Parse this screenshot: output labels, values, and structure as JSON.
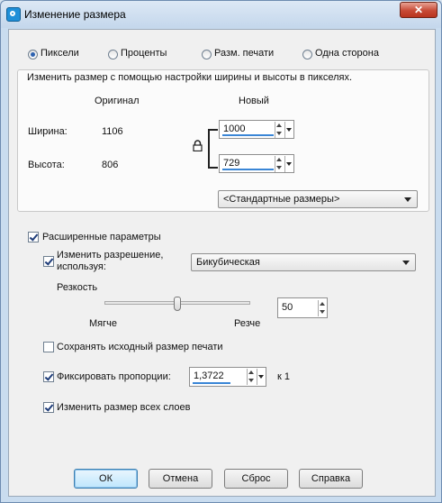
{
  "window": {
    "title": "Изменение размера",
    "close_glyph": "✕"
  },
  "mode": {
    "options": [
      "Пиксели",
      "Проценты",
      "Разм. печати",
      "Одна сторона"
    ],
    "selected": "Пиксели"
  },
  "dimensions": {
    "description": "Изменить размер с помощью настройки ширины и высоты в пикселях.",
    "original_header": "Оригинал",
    "new_header": "Новый",
    "width_label": "Ширина:",
    "width_original": "1106",
    "width_new": "1000",
    "height_label": "Высота:",
    "height_original": "806",
    "height_new": "729",
    "preset_value": "<Стандартные размеры>"
  },
  "advanced": {
    "label": "Расширенные параметры",
    "checked": true,
    "resample_label_line1": "Изменить разрешение,",
    "resample_label_line2": "используя:",
    "resample_checked": true,
    "resample_method": "Бикубическая",
    "sharpness_label": "Резкость",
    "sharpness_value": "50",
    "sharpness_level": 0.5,
    "softer_label": "Мягче",
    "sharper_label": "Резче",
    "keep_print_label": "Сохранять исходный размер печати",
    "keep_print_checked": false,
    "lock_ratio_label": "Фиксировать пропорции:",
    "lock_ratio_checked": true,
    "ratio_value": "1,3722",
    "ratio_suffix": "к 1",
    "all_layers_label": "Изменить размер всех слоев",
    "all_layers_checked": true
  },
  "buttons": {
    "ok": "ОК",
    "cancel": "Отмена",
    "reset": "Сброс",
    "help": "Справка"
  },
  "colors": {
    "accent": "#3a86d6",
    "frame": "#c9dcef",
    "close": "#c74a36"
  }
}
